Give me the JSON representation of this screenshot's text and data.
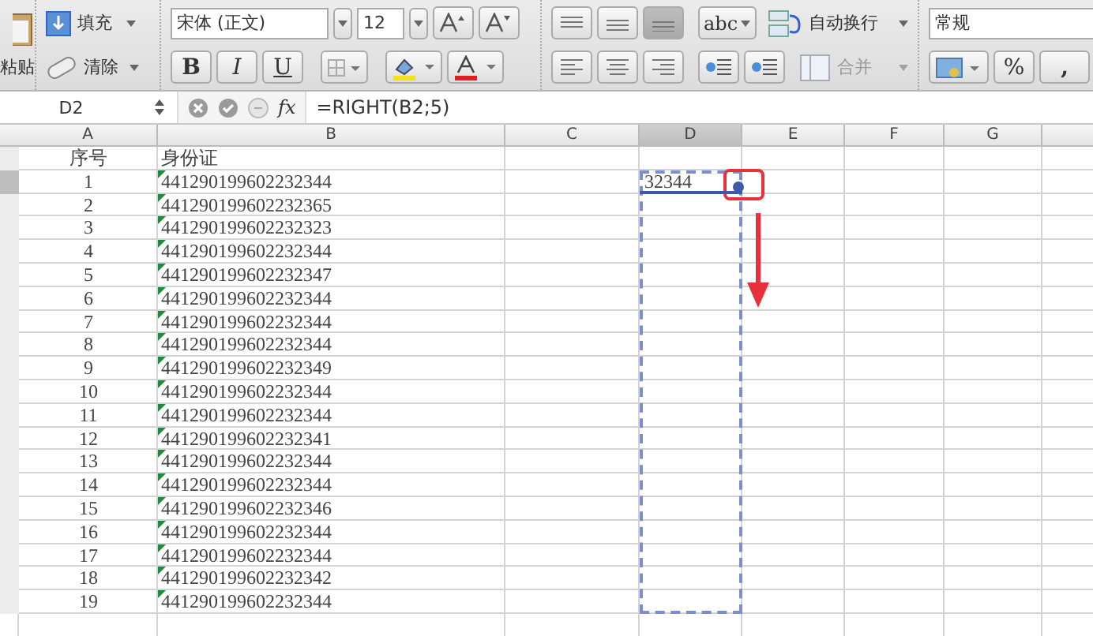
{
  "toolbar": {
    "paste_label": "粘贴",
    "fill_label": "填充",
    "clear_label": "清除",
    "font_name": "宋体 (正文)",
    "font_size": "12",
    "bold_label": "B",
    "italic_label": "I",
    "underline_label": "U",
    "orientation_label": "abc",
    "wrap_label": "自动换行",
    "merge_label": "合并",
    "number_format": "常规",
    "percent_label": "%",
    "comma_label": ","
  },
  "formula_bar": {
    "cell_ref": "D2",
    "fx_label": "fx",
    "formula": "=RIGHT(B2;5)"
  },
  "sheet": {
    "columns": [
      {
        "label": "A",
        "selected": false
      },
      {
        "label": "B",
        "selected": false
      },
      {
        "label": "C",
        "selected": false
      },
      {
        "label": "D",
        "selected": true
      },
      {
        "label": "E",
        "selected": false
      },
      {
        "label": "F",
        "selected": false
      },
      {
        "label": "G",
        "selected": false
      }
    ],
    "rows": [
      {
        "selected": false,
        "a": "序号",
        "b": "身份证",
        "flag": false
      },
      {
        "selected": true,
        "a": "1",
        "b": "441290199602232344",
        "flag": true,
        "d": "32344"
      },
      {
        "selected": false,
        "a": "2",
        "b": "441290199602232365",
        "flag": true
      },
      {
        "selected": false,
        "a": "3",
        "b": "441290199602232323",
        "flag": true
      },
      {
        "selected": false,
        "a": "4",
        "b": "441290199602232344",
        "flag": true
      },
      {
        "selected": false,
        "a": "5",
        "b": "441290199602232347",
        "flag": true
      },
      {
        "selected": false,
        "a": "6",
        "b": "441290199602232344",
        "flag": true
      },
      {
        "selected": false,
        "a": "7",
        "b": "441290199602232344",
        "flag": true
      },
      {
        "selected": false,
        "a": "8",
        "b": "441290199602232344",
        "flag": true
      },
      {
        "selected": false,
        "a": "9",
        "b": "441290199602232349",
        "flag": true
      },
      {
        "selected": false,
        "a": "10",
        "b": "441290199602232344",
        "flag": true
      },
      {
        "selected": false,
        "a": "11",
        "b": "441290199602232344",
        "flag": true
      },
      {
        "selected": false,
        "a": "12",
        "b": "441290199602232341",
        "flag": true
      },
      {
        "selected": false,
        "a": "13",
        "b": "441290199602232344",
        "flag": true
      },
      {
        "selected": false,
        "a": "14",
        "b": "441290199602232344",
        "flag": true
      },
      {
        "selected": false,
        "a": "15",
        "b": "441290199602232346",
        "flag": true
      },
      {
        "selected": false,
        "a": "16",
        "b": "441290199602232344",
        "flag": true
      },
      {
        "selected": false,
        "a": "17",
        "b": "441290199602232344",
        "flag": true
      },
      {
        "selected": false,
        "a": "18",
        "b": "441290199602232342",
        "flag": true
      },
      {
        "selected": false,
        "a": "19",
        "b": "441290199602232344",
        "flag": true
      }
    ]
  }
}
